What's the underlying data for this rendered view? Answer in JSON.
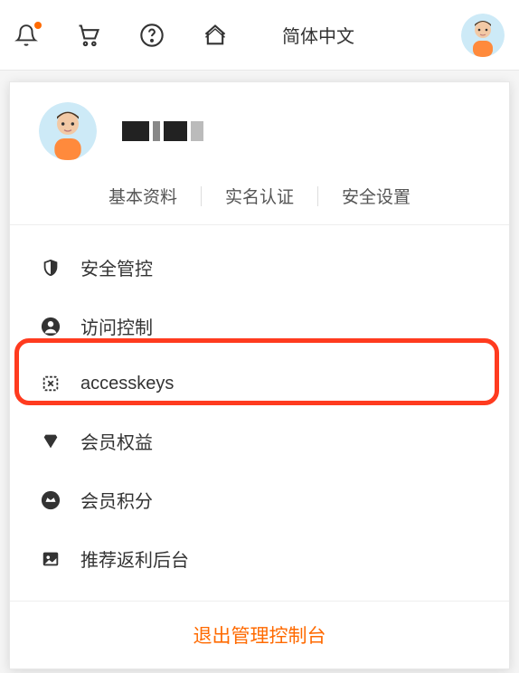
{
  "topbar": {
    "language": "简体中文"
  },
  "dropdown": {
    "tabs": {
      "profile": "基本资料",
      "verify": "实名认证",
      "security": "安全设置"
    },
    "menu": {
      "security_control": "安全管控",
      "access_control": "访问控制",
      "accesskeys": "accesskeys",
      "member_benefits": "会员权益",
      "member_points": "会员积分",
      "referral": "推荐返利后台"
    },
    "logout": "退出管理控制台"
  }
}
